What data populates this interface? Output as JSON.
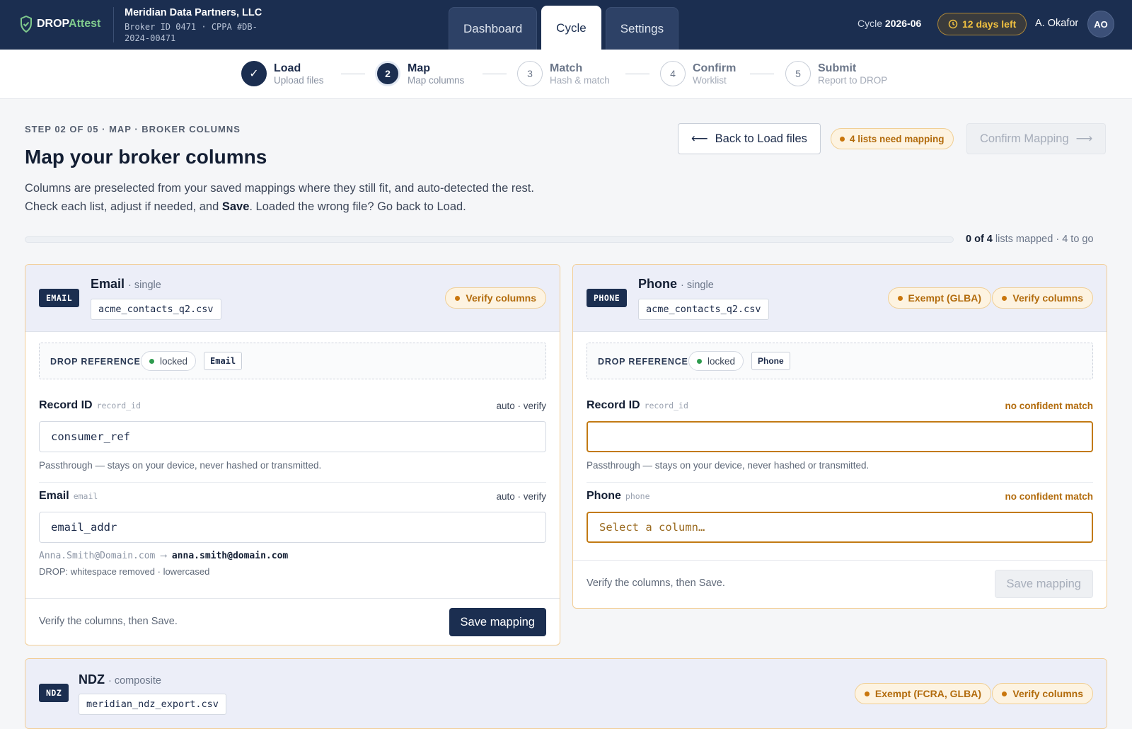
{
  "app": {
    "logo_drop": "DROP",
    "logo_attest": "Attest",
    "company": "Meridian Data Partners, LLC",
    "broker_meta": "Broker ID 0471 · CPPA #DB-2024-00471"
  },
  "nav": {
    "tabs": [
      "Dashboard",
      "Cycle",
      "Settings"
    ],
    "active_tab": "Cycle"
  },
  "header": {
    "cycle_label": "Cycle",
    "cycle_value": "2026-06",
    "days_left": "12 days left",
    "user_name": "A. Okafor",
    "user_initials": "AO"
  },
  "stepper": [
    {
      "num": "✓",
      "title": "Load",
      "sub": "Upload files",
      "state": "done"
    },
    {
      "num": "2",
      "title": "Map",
      "sub": "Map columns",
      "state": "current"
    },
    {
      "num": "3",
      "title": "Match",
      "sub": "Hash & match",
      "state": "future"
    },
    {
      "num": "4",
      "title": "Confirm",
      "sub": "Worklist",
      "state": "future"
    },
    {
      "num": "5",
      "title": "Submit",
      "sub": "Report to DROP",
      "state": "future"
    }
  ],
  "page": {
    "eyebrow": "STEP 02 OF 05 · MAP · BROKER COLUMNS",
    "title": "Map your broker columns",
    "desc_line1": "Columns are preselected from your saved mappings where they still fit, and auto-detected the rest.",
    "desc_line2_a": "Check each list, adjust if needed, and ",
    "desc_line2_b": "Save",
    "desc_line2_c": ". Loaded the wrong file? Go back to Load.",
    "back_button": "Back to Load files",
    "need_mapping": "4 lists need mapping",
    "confirm_button": "Confirm Mapping",
    "progress_fraction": 0,
    "progress_count": "0 of 4",
    "progress_rest": "lists mapped · 4 to go"
  },
  "colors": {
    "navy": "#1b2e50",
    "amber": "#b26b0c",
    "green": "#2e9b4e"
  },
  "cards": {
    "email": {
      "tag": "EMAIL",
      "title": "Email",
      "kind": "· single",
      "file": "acme_contacts_q2.csv",
      "pills": [
        "Verify columns"
      ],
      "ref_label": "DROP REFERENCE",
      "ref_status": "locked",
      "ref_chip": "Email",
      "fields": [
        {
          "label": "Record ID",
          "key": "record_id",
          "status": "auto · verify",
          "value": "consumer_ref",
          "hint": "Passthrough — stays on your device, never hashed or transmitted."
        },
        {
          "label": "Email",
          "key": "email",
          "status": "auto · verify",
          "value": "email_addr",
          "sample_in": "Anna.Smith@Domain.com",
          "sample_out": "anna.smith@domain.com",
          "sample_note": "DROP: whitespace removed · lowercased"
        }
      ],
      "footer_text": "Verify the columns, then Save.",
      "save_button": "Save mapping"
    },
    "phone": {
      "tag": "PHONE",
      "title": "Phone",
      "kind": "· single",
      "file": "acme_contacts_q2.csv",
      "pills": [
        "Exempt (GLBA)",
        "Verify columns"
      ],
      "ref_label": "DROP REFERENCE",
      "ref_status": "locked",
      "ref_chip": "Phone",
      "fields": [
        {
          "label": "Record ID",
          "key": "record_id",
          "status": "no confident match",
          "value": "",
          "hint": "Passthrough — stays on your device, never hashed or transmitted."
        },
        {
          "label": "Phone",
          "key": "phone",
          "status": "no confident match",
          "value": "",
          "placeholder": "Select a column…"
        }
      ],
      "footer_text": "Verify the columns, then Save.",
      "save_button": "Save mapping"
    },
    "ndz": {
      "tag": "NDZ",
      "title": "NDZ",
      "kind": "· composite",
      "file": "meridian_ndz_export.csv",
      "pills": [
        "Exempt (FCRA, GLBA)",
        "Verify columns"
      ]
    }
  }
}
